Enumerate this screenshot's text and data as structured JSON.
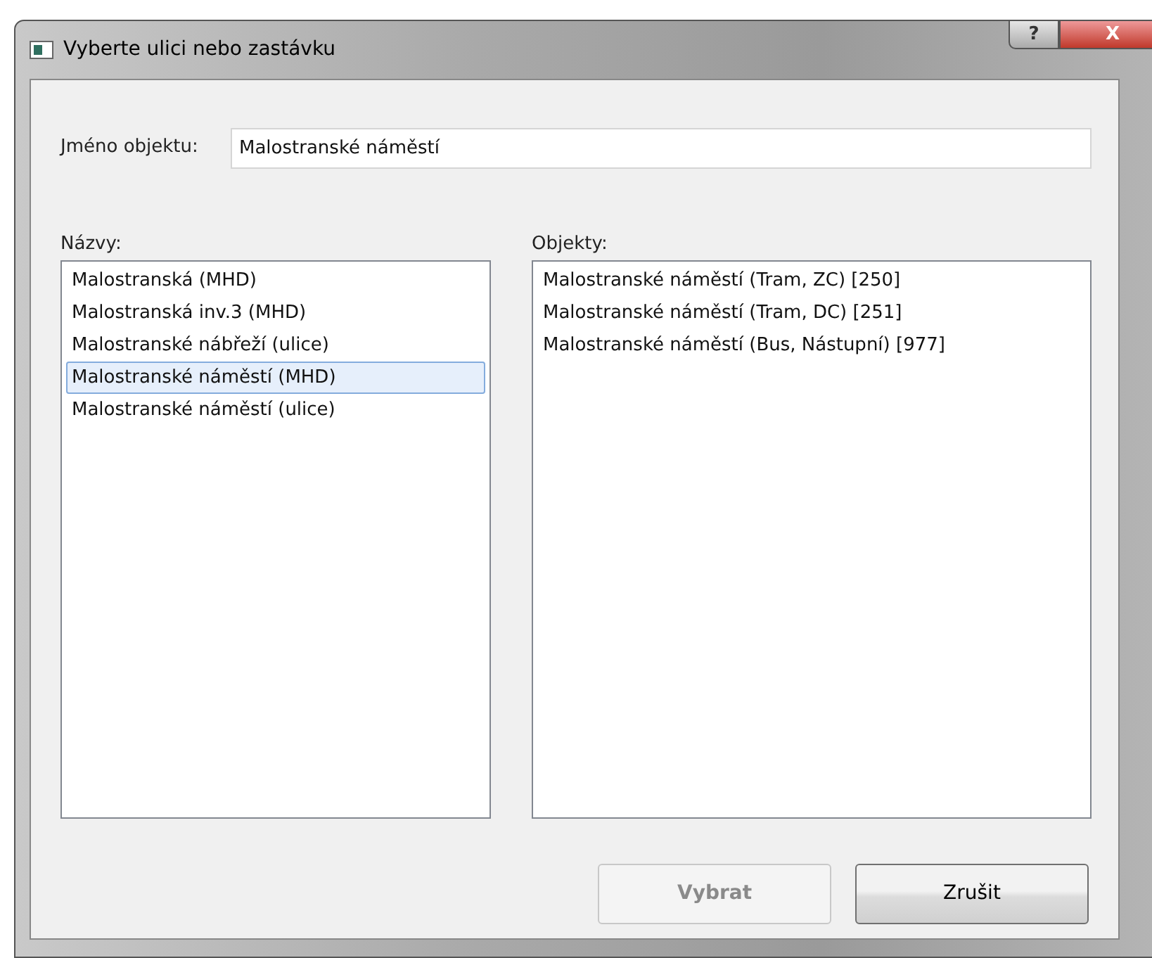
{
  "window": {
    "title": "Vyberte ulici nebo zastávku",
    "help_button": "?",
    "close_button": "X"
  },
  "name_field": {
    "label": "Jméno objektu:",
    "value": "Malostranské náměstí"
  },
  "names": {
    "label": "Názvy:",
    "items": [
      {
        "text": "Malostranská (MHD)",
        "selected": false
      },
      {
        "text": "Malostranská inv.3 (MHD)",
        "selected": false
      },
      {
        "text": "Malostranské nábřeží (ulice)",
        "selected": false
      },
      {
        "text": "Malostranské náměstí (MHD)",
        "selected": true
      },
      {
        "text": "Malostranské náměstí (ulice)",
        "selected": false
      }
    ]
  },
  "objects": {
    "label": "Objekty:",
    "items": [
      {
        "text": "Malostranské náměstí (Tram, ZC) [250]",
        "selected": false
      },
      {
        "text": "Malostranské náměstí (Tram, DC) [251]",
        "selected": false
      },
      {
        "text": "Malostranské náměstí (Bus, Nástupní) [977]",
        "selected": false
      }
    ]
  },
  "buttons": [
    {
      "label": "Vybrat",
      "disabled": true
    },
    {
      "label": "Zrušit",
      "disabled": false
    }
  ]
}
